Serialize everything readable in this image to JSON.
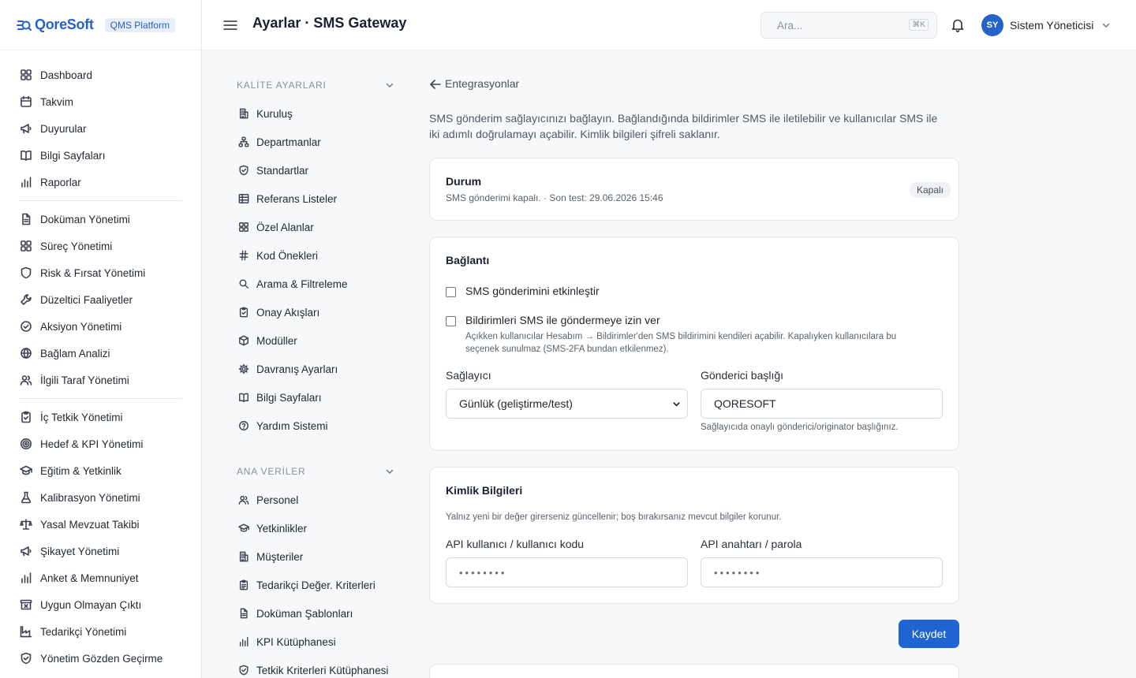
{
  "brand": {
    "logo_text": "QoreSoft",
    "platform_badge": "QMS Platform",
    "accent": "#2563c9"
  },
  "sidebar": {
    "groups": [
      [
        {
          "label": "Dashboard",
          "icon": "grid-icon"
        },
        {
          "label": "Takvim",
          "icon": "calendar-icon"
        },
        {
          "label": "Duyurular",
          "icon": "megaphone-icon"
        },
        {
          "label": "Bilgi Sayfaları",
          "icon": "book-icon"
        },
        {
          "label": "Raporlar",
          "icon": "bar-chart-icon"
        }
      ],
      [
        {
          "label": "Doküman Yönetimi",
          "icon": "file-icon"
        },
        {
          "label": "Süreç Yönetimi",
          "icon": "grid-icon"
        },
        {
          "label": "Risk & Fırsat Yönetimi",
          "icon": "shield-icon"
        },
        {
          "label": "Düzeltici Faaliyetler",
          "icon": "wrench-icon"
        },
        {
          "label": "Aksiyon Yönetimi",
          "icon": "check-circle-icon"
        },
        {
          "label": "Bağlam Analizi",
          "icon": "globe-icon"
        },
        {
          "label": "İlgili Taraf Yönetimi",
          "icon": "users-icon"
        }
      ],
      [
        {
          "label": "İç Tetkik Yönetimi",
          "icon": "clipboard-check-icon"
        },
        {
          "label": "Hedef & KPI Yönetimi",
          "icon": "target-icon"
        },
        {
          "label": "Eğitim & Yetkinlik",
          "icon": "graduation-cap-icon"
        },
        {
          "label": "Kalibrasyon Yönetimi",
          "icon": "flask-icon"
        },
        {
          "label": "Yasal Mevzuat Takibi",
          "icon": "scale-icon"
        },
        {
          "label": "Şikayet Yönetimi",
          "icon": "megaphone-icon"
        },
        {
          "label": "Anket & Memnuniyet",
          "icon": "bar-chart-icon"
        },
        {
          "label": "Uygun Olmayan Çıktı",
          "icon": "archive-x-icon"
        },
        {
          "label": "Tedarikçi Yönetimi",
          "icon": "factory-icon"
        },
        {
          "label": "Yönetim Gözden Geçirme",
          "icon": "shield-check-icon"
        }
      ]
    ]
  },
  "topbar": {
    "title": "Ayarlar · SMS Gateway",
    "search_placeholder": "Ara...",
    "search_shortcut": "⌘K",
    "user_initials": "SY",
    "user_name": "Sistem Yöneticisi"
  },
  "subnav": {
    "groups": [
      {
        "title": "KALİTE AYARLARI",
        "items": [
          {
            "label": "Kuruluş",
            "icon": "building-icon"
          },
          {
            "label": "Departmanlar",
            "icon": "network-icon"
          },
          {
            "label": "Standartlar",
            "icon": "shield-check-icon"
          },
          {
            "label": "Referans Listeler",
            "icon": "table-icon"
          },
          {
            "label": "Özel Alanlar",
            "icon": "grid-icon"
          },
          {
            "label": "Kod Önekleri",
            "icon": "hash-icon"
          },
          {
            "label": "Arama & Filtreleme",
            "icon": "search-icon"
          },
          {
            "label": "Onay Akışları",
            "icon": "clipboard-check-icon"
          },
          {
            "label": "Modüller",
            "icon": "box-icon"
          },
          {
            "label": "Davranış Ayarları",
            "icon": "gear-icon"
          },
          {
            "label": "Bilgi Sayfaları",
            "icon": "book-icon"
          },
          {
            "label": "Yardım Sistemi",
            "icon": "help-circle-icon"
          }
        ]
      },
      {
        "title": "ANA VERİLER",
        "items": [
          {
            "label": "Personel",
            "icon": "users-icon"
          },
          {
            "label": "Yetkinlikler",
            "icon": "graduation-cap-icon"
          },
          {
            "label": "Müşteriler",
            "icon": "building-icon"
          },
          {
            "label": "Tedarikçi Değer. Kriterleri",
            "icon": "clipboard-list-icon"
          },
          {
            "label": "Doküman Şablonları",
            "icon": "file-icon"
          },
          {
            "label": "KPI Kütüphanesi",
            "icon": "bar-chart-icon"
          },
          {
            "label": "Tetkik Kriterleri Kütüphanesi",
            "icon": "shield-check-icon"
          }
        ]
      }
    ]
  },
  "main": {
    "back_label": "Entegrasyonlar",
    "intro": "SMS gönderim sağlayıcınızı bağlayın. Bağlandığında bildirimler SMS ile iletilebilir ve kullanıcılar SMS ile iki adımlı doğrulamayı açabilir. Kimlik bilgileri şifreli saklanır.",
    "status": {
      "title": "Durum",
      "subtitle": "SMS gönderimi kapalı. · Son test: 29.06.2026 15:46",
      "badge": "Kapalı"
    },
    "connection": {
      "title": "Bağlantı",
      "enable_label": "SMS gönderimini etkinleştir",
      "enable_checked": false,
      "notify_label": "Bildirimleri SMS ile göndermeye izin ver",
      "notify_checked": false,
      "notify_help": "Açıkken kullanıcılar Hesabım → Bildirimler'den SMS bildirimini kendileri açabilir. Kapalıyken kullanıcılara bu seçenek sunulmaz (SMS-2FA bundan etkilenmez).",
      "provider_label": "Sağlayıcı",
      "provider_value": "Günlük (geliştirme/test)",
      "sender_label": "Gönderici başlığı",
      "sender_value": "QORESOFT",
      "sender_help": "Sağlayıcıda onaylı gönderici/originator başlığınız."
    },
    "credentials": {
      "title": "Kimlik Bilgileri",
      "help": "Yalnız yeni bir değer girerseniz güncellenir; boş bırakırsanız mevcut bilgiler korunur.",
      "api_user_label": "API kullanıcı / kullanıcı kodu",
      "api_user_placeholder": "••••••••",
      "api_key_label": "API anahtarı / parola",
      "api_key_placeholder": "••••••••"
    },
    "save_label": "Kaydet",
    "save_color": "#1f64d0"
  }
}
